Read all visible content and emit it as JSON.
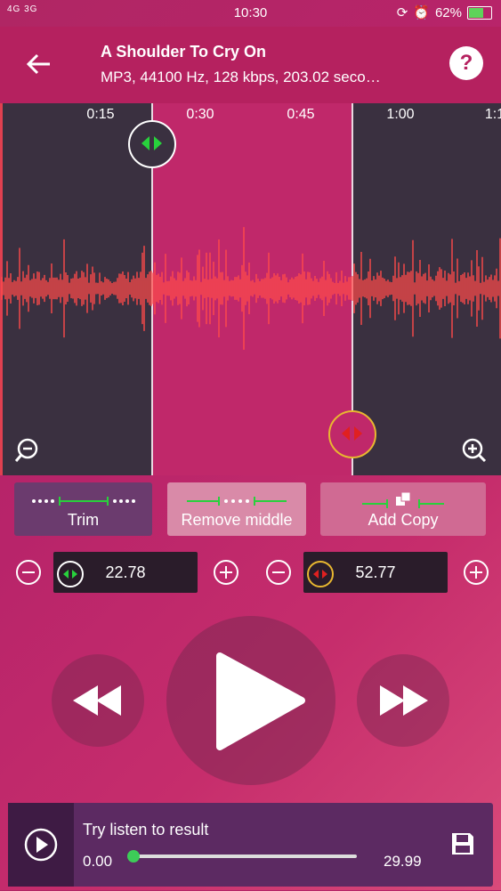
{
  "status": {
    "signal": "4G 3G",
    "time": "10:30",
    "battery": "62%",
    "battery_level": 0.62
  },
  "header": {
    "title": "A Shoulder To Cry On",
    "subtitle": "MP3, 44100 Hz, 128 kbps, 203.02 seco…",
    "help_label": "?"
  },
  "timeline": {
    "ticks": [
      "0:15",
      "0:30",
      "0:45",
      "1:00",
      "1:1"
    ]
  },
  "actions": {
    "trim": "Trim",
    "remove_middle": "Remove middle",
    "add_copy": "Add Copy"
  },
  "values": {
    "start": "22.78",
    "end": "52.77"
  },
  "player": {
    "caption": "Try listen to result",
    "time_start": "0.00",
    "time_end": "29.99",
    "progress": 0.0
  },
  "colors": {
    "accent": "#b5215f",
    "wave": "#ff4a4a",
    "green": "#28d13c",
    "red": "#e02020",
    "gold": "#e8b730"
  }
}
